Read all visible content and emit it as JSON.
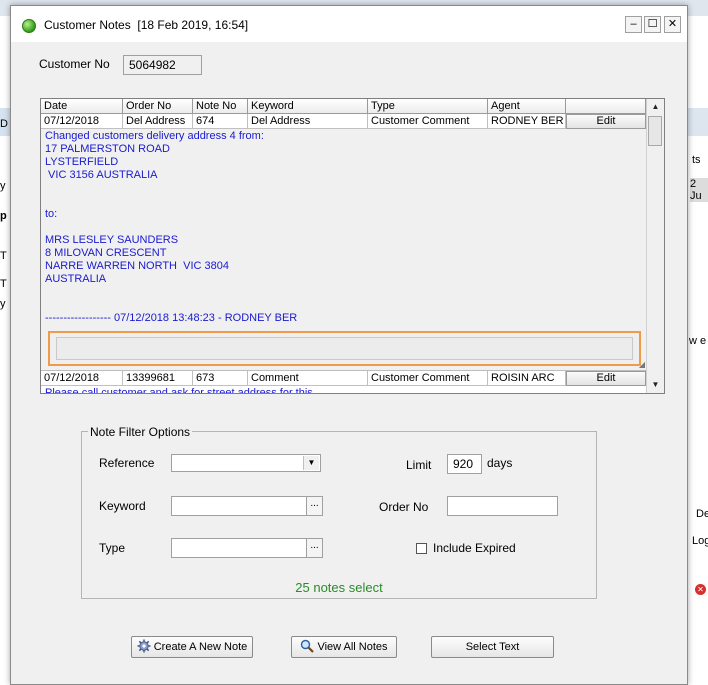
{
  "window": {
    "title": "Customer Notes",
    "timestamp": "[18 Feb 2019, 16:54]"
  },
  "customer": {
    "label": "Customer No",
    "value": "5064982"
  },
  "grid": {
    "columns": [
      "Date",
      "Order No",
      "Note No",
      "Keyword",
      "Type",
      "Agent"
    ],
    "rows": [
      {
        "date": "07/12/2018",
        "order_no": "Del Address",
        "note_no": "674",
        "keyword": "Del Address",
        "type": "Customer Comment",
        "agent": "RODNEY BER",
        "action": "Edit"
      },
      {
        "date": "07/12/2018",
        "order_no": "13399681",
        "note_no": "673",
        "keyword": "Comment",
        "type": "Customer Comment",
        "agent": "ROISIN ARC",
        "action": "Edit"
      }
    ],
    "expanded_note": [
      "Changed customers delivery address 4 from:",
      "17 PALMERSTON ROAD",
      "LYSTERFIELD",
      " VIC 3156 AUSTRALIA",
      "",
      "",
      "to:",
      "",
      "MRS LESLEY SAUNDERS",
      "8 MILOVAN CRESCENT",
      "NARRE WARREN NORTH  VIC 3804",
      "AUSTRALIA",
      "",
      "------------------ 07/12/2018 13:48:23 - RODNEY BER"
    ],
    "second_note_preview": "Please call customer and ask for street address for this"
  },
  "filter": {
    "group_title": "Note Filter Options",
    "reference_label": "Reference",
    "reference_value": "",
    "limit_label": "Limit",
    "limit_value": "920",
    "limit_unit": "days",
    "keyword_label": "Keyword",
    "keyword_value": "",
    "order_no_label": "Order No",
    "order_no_value": "",
    "type_label": "Type",
    "type_value": "",
    "include_expired_label": "Include Expired",
    "include_expired_checked": false,
    "status": "25 notes select"
  },
  "buttons": {
    "create": "Create A New Note",
    "view_all": "View All Notes",
    "select_text": "Select Text"
  },
  "background_app": {
    "left_fragments": [
      "D",
      "y",
      "p",
      "T",
      "T",
      "y"
    ],
    "right_fragments": [
      "ts",
      "2 Ju",
      "w e",
      "De",
      "Log"
    ]
  }
}
